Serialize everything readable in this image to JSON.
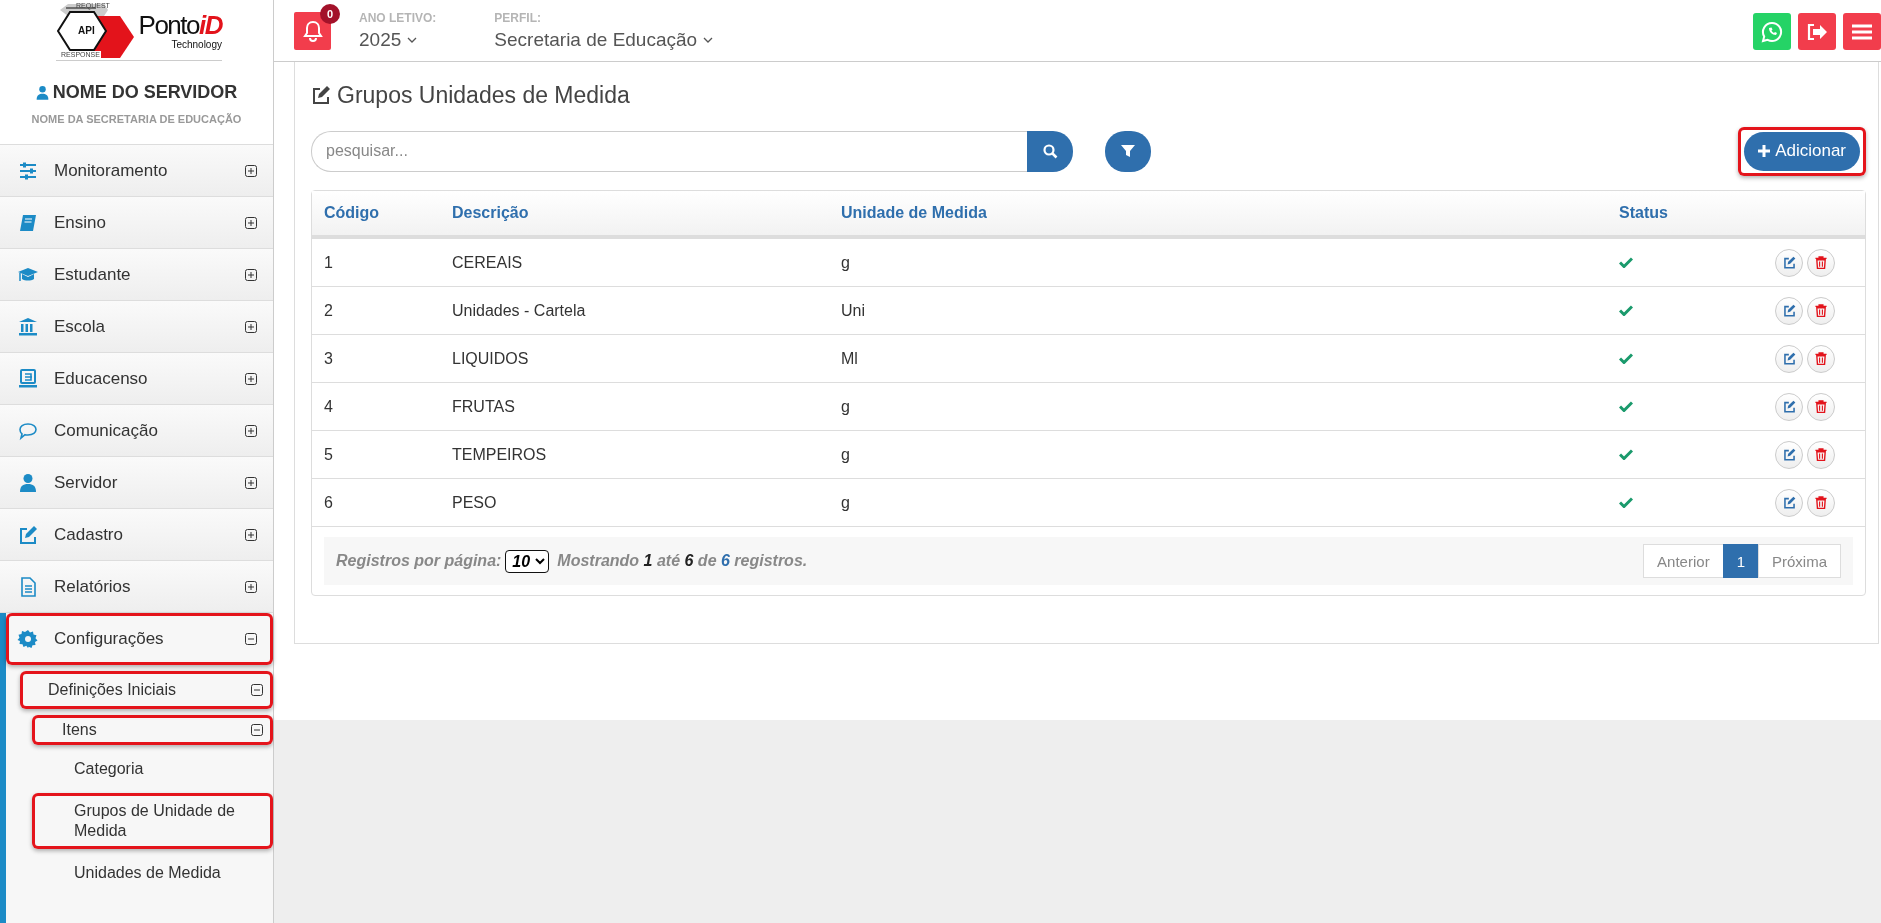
{
  "logo": {
    "request": "REQUEST",
    "api": "API",
    "response": "RESPONSE",
    "brand": "Ponto",
    "brand_accent": "iD",
    "tagline": "Technology"
  },
  "topbar": {
    "notifications": {
      "count": "0"
    },
    "year": {
      "label": "ANO LETIVO:",
      "value": "2025"
    },
    "profile": {
      "label": "PERFIL:",
      "value": "Secretaria de Educação"
    }
  },
  "user": {
    "name": "NOME DO SERVIDOR",
    "department": "NOME DA SECRETARIA DE EDUCAÇÃO"
  },
  "sidebar": {
    "items": [
      {
        "label": "Monitoramento",
        "expanded": false,
        "highlighted": false
      },
      {
        "label": "Ensino",
        "expanded": false,
        "highlighted": false
      },
      {
        "label": "Estudante",
        "expanded": false,
        "highlighted": false
      },
      {
        "label": "Escola",
        "expanded": false,
        "highlighted": false
      },
      {
        "label": "Educacenso",
        "expanded": false,
        "highlighted": false
      },
      {
        "label": "Comunicação",
        "expanded": false,
        "highlighted": false
      },
      {
        "label": "Servidor",
        "expanded": false,
        "highlighted": false
      },
      {
        "label": "Cadastro",
        "expanded": false,
        "highlighted": false
      },
      {
        "label": "Relatórios",
        "expanded": false,
        "highlighted": false
      },
      {
        "label": "Configurações",
        "expanded": true,
        "highlighted": true,
        "children": [
          {
            "label": "Definições Iniciais",
            "expanded": true,
            "highlighted": true,
            "children": [
              {
                "label": "Itens",
                "expanded": true,
                "highlighted": true,
                "children": [
                  {
                    "label": "Categoria",
                    "highlighted": false
                  },
                  {
                    "label": "Grupos de Unidade de Medida",
                    "highlighted": true
                  },
                  {
                    "label": "Unidades de Medida",
                    "highlighted": false
                  }
                ]
              }
            ]
          }
        ]
      }
    ]
  },
  "page": {
    "title": "Grupos Unidades de Medida",
    "search": {
      "placeholder": "pesquisar..."
    },
    "add_button": {
      "label": "Adicionar",
      "highlighted": true
    }
  },
  "table": {
    "columns": [
      "Código",
      "Descrição",
      "Unidade de Medida",
      "Status"
    ],
    "rows": [
      {
        "code": "1",
        "description": "CEREAIS",
        "unit": "g",
        "active": true
      },
      {
        "code": "2",
        "description": "Unidades - Cartela",
        "unit": "Uni",
        "active": true
      },
      {
        "code": "3",
        "description": "LIQUIDOS",
        "unit": "Ml",
        "active": true
      },
      {
        "code": "4",
        "description": "FRUTAS",
        "unit": "g",
        "active": true
      },
      {
        "code": "5",
        "description": "TEMPEIROS",
        "unit": "g",
        "active": true
      },
      {
        "code": "6",
        "description": "PESO",
        "unit": "g",
        "active": true
      }
    ]
  },
  "footer": {
    "per_page_label": "Registros por página:",
    "per_page": "10",
    "summary": "Mostrando **1** até **6** de **6** registros.",
    "pagination": [
      {
        "label": "Anterior",
        "selected": false
      },
      {
        "label": "1",
        "selected": true
      },
      {
        "label": "Próxima",
        "selected": false
      }
    ]
  }
}
